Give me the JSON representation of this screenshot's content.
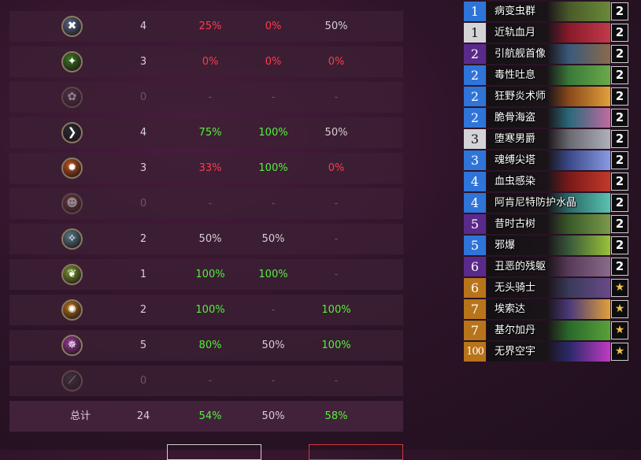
{
  "colors": {
    "red": "#ff3b4a",
    "green": "#53f23a",
    "neutral": "#d8d0d4"
  },
  "rows": [
    {
      "icon": "axe-crossed-icon",
      "bg": "#5a6a86",
      "glyph": "✖",
      "n": "4",
      "a": "25%",
      "b": "0%",
      "c": "50%",
      "ca": "red",
      "cb": "red",
      "cc": "neutral",
      "dim": false
    },
    {
      "icon": "green-claw-icon",
      "bg": "#3c7a1c",
      "glyph": "✦",
      "n": "3",
      "a": "0%",
      "b": "0%",
      "c": "0%",
      "ca": "red",
      "cb": "red",
      "cc": "red",
      "dim": false
    },
    {
      "icon": "paw-icon",
      "bg": "#6a4a5e",
      "glyph": "✿",
      "n": "0",
      "a": "-",
      "b": "-",
      "c": "-",
      "ca": "dim",
      "cb": "dim",
      "cc": "dim",
      "dim": true
    },
    {
      "icon": "dark-blade-icon",
      "bg": "#2a2a2e",
      "glyph": "❯",
      "n": "4",
      "a": "75%",
      "b": "100%",
      "c": "50%",
      "ca": "green",
      "cb": "green",
      "cc": "neutral",
      "dim": false
    },
    {
      "icon": "fire-orb-icon",
      "bg": "#c2541a",
      "glyph": "✹",
      "n": "3",
      "a": "33%",
      "b": "100%",
      "c": "0%",
      "ca": "red",
      "cb": "green",
      "cc": "red",
      "dim": false
    },
    {
      "icon": "bronze-face-icon",
      "bg": "#8a5a3a",
      "glyph": "☻",
      "n": "0",
      "a": "-",
      "b": "-",
      "c": "-",
      "ca": "dim",
      "cb": "dim",
      "cc": "dim",
      "dim": true
    },
    {
      "icon": "lightning-fist-icon",
      "bg": "#5a7a8a",
      "glyph": "✧",
      "n": "2",
      "a": "50%",
      "b": "50%",
      "c": "-",
      "ca": "neutral",
      "cb": "neutral",
      "cc": "dim",
      "dim": false
    },
    {
      "icon": "nature-leaf-icon",
      "bg": "#7a9a2a",
      "glyph": "❦",
      "n": "1",
      "a": "100%",
      "b": "100%",
      "c": "-",
      "ca": "green",
      "cb": "green",
      "cc": "dim",
      "dim": false
    },
    {
      "icon": "golden-lion-icon",
      "bg": "#b8741a",
      "glyph": "✺",
      "n": "2",
      "a": "100%",
      "b": "-",
      "c": "100%",
      "ca": "green",
      "cb": "dim",
      "cc": "green",
      "dim": false
    },
    {
      "icon": "arcane-burst-icon",
      "bg": "#9a3a9a",
      "glyph": "✵",
      "n": "5",
      "a": "80%",
      "b": "50%",
      "c": "100%",
      "ca": "green",
      "cb": "neutral",
      "cc": "green",
      "dim": false
    },
    {
      "icon": "grey-dagger-icon",
      "bg": "#4a4a54",
      "glyph": "⟋",
      "n": "0",
      "a": "-",
      "b": "-",
      "c": "-",
      "ca": "dim",
      "cb": "dim",
      "cc": "dim",
      "dim": true
    }
  ],
  "total": {
    "label": "总计",
    "n": "24",
    "a": "54%",
    "b": "50%",
    "c": "58%",
    "ca": "green",
    "cb": "neutral",
    "cc": "green"
  },
  "deck": [
    {
      "cost": "1",
      "name": "病变虫群",
      "count": "2",
      "rarity": "common",
      "art": [
        "#4a5a2a",
        "#6a8a3a"
      ]
    },
    {
      "cost": "1",
      "name": "近轨血月",
      "count": "2",
      "rarity": "free",
      "art": [
        "#8a1a2a",
        "#c23a4a"
      ]
    },
    {
      "cost": "2",
      "name": "引航舰首像",
      "count": "2",
      "rarity": "epic",
      "art": [
        "#3a5a7a",
        "#8a6a4a"
      ]
    },
    {
      "cost": "2",
      "name": "毒性吐息",
      "count": "2",
      "rarity": "common",
      "art": [
        "#3a7a3a",
        "#6aaa4a"
      ]
    },
    {
      "cost": "2",
      "name": "狂野炎术师",
      "count": "2",
      "rarity": "common",
      "art": [
        "#8a4a1a",
        "#e2a03a"
      ]
    },
    {
      "cost": "2",
      "name": "脆骨海盗",
      "count": "2",
      "rarity": "common",
      "art": [
        "#2a6a7a",
        "#c26aa0"
      ]
    },
    {
      "cost": "3",
      "name": "堕寒男爵",
      "count": "2",
      "rarity": "free",
      "art": [
        "#6a6a72",
        "#b0b0b8"
      ]
    },
    {
      "cost": "3",
      "name": "魂缚尖塔",
      "count": "2",
      "rarity": "common",
      "art": [
        "#3a4a8a",
        "#8a9ae2"
      ]
    },
    {
      "cost": "4",
      "name": "血虫感染",
      "count": "2",
      "rarity": "common",
      "art": [
        "#7a1a1a",
        "#c23a2a"
      ]
    },
    {
      "cost": "4",
      "name": "阿肯尼特防护水晶",
      "count": "2",
      "rarity": "common",
      "art": [
        "#2a6a6a",
        "#5ac2b0"
      ]
    },
    {
      "cost": "5",
      "name": "昔时古树",
      "count": "2",
      "rarity": "epic",
      "art": [
        "#3a5a2a",
        "#7a9a4a"
      ]
    },
    {
      "cost": "5",
      "name": "邪爆",
      "count": "2",
      "rarity": "common",
      "art": [
        "#3a5a3a",
        "#9ac23a"
      ]
    },
    {
      "cost": "6",
      "name": "丑恶的残躯",
      "count": "2",
      "rarity": "epic",
      "art": [
        "#5a3a5a",
        "#8a6a8a"
      ]
    },
    {
      "cost": "6",
      "name": "无头骑士",
      "count": "★",
      "rarity": "legendary",
      "art": [
        "#3a3a5a",
        "#6a4a8a"
      ]
    },
    {
      "cost": "7",
      "name": "埃索达",
      "count": "★",
      "rarity": "legendary",
      "art": [
        "#4a3a7a",
        "#e2a03a"
      ]
    },
    {
      "cost": "7",
      "name": "基尔加丹",
      "count": "★",
      "rarity": "legendary",
      "art": [
        "#2a6a2a",
        "#5aa03a"
      ]
    },
    {
      "cost": "100",
      "name": "无界空宇",
      "count": "★",
      "rarity": "legendary",
      "art": [
        "#2a2a6a",
        "#c23ac2"
      ]
    }
  ],
  "rarity_colors": {
    "common": "#2f74d8",
    "free": "#d4d4d8",
    "epic": "#5a2a8a",
    "legendary": "#b8741a"
  }
}
